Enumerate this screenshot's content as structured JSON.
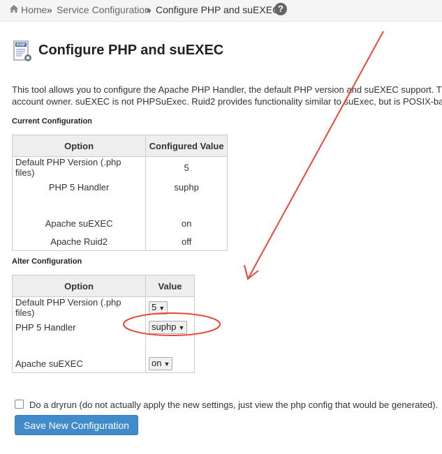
{
  "breadcrumb": {
    "home": "Home",
    "sep": "»",
    "service_config": "Service Configuration",
    "current": "Configure PHP and suEXEC",
    "help": "?"
  },
  "page": {
    "title": "Configure PHP and suEXEC",
    "desc_line1": "This tool allows you to configure the Apache PHP Handler, the default PHP version and suEXEC support. T",
    "desc_line2": "account owner. suEXEC is not PHPSuExec. Ruid2 provides functionality similar to suExec, but is POSIX-ba"
  },
  "current": {
    "heading": "Current Configuration",
    "col_option": "Option",
    "col_value": "Configured Value",
    "rows": [
      {
        "option": "Default PHP Version (.php files)",
        "value": "5"
      },
      {
        "option": "PHP 5 Handler",
        "value": "suphp"
      },
      {
        "option": "",
        "value": ""
      },
      {
        "option": "Apache suEXEC",
        "value": "on"
      },
      {
        "option": "Apache Ruid2",
        "value": "off"
      }
    ]
  },
  "alter": {
    "heading": "Alter Configuration",
    "col_option": "Option",
    "col_value": "Value",
    "rows": [
      {
        "option": "Default PHP Version (.php files)",
        "value": "5"
      },
      {
        "option": "PHP 5 Handler",
        "value": "suphp"
      },
      {
        "option": "",
        "value": ""
      },
      {
        "option": "Apache suEXEC",
        "value": "on"
      }
    ]
  },
  "dryrun_label": "Do a dryrun (do not actually apply the new settings, just view the php config that would be generated).",
  "save_label": "Save New Configuration",
  "colors": {
    "primary_button": "#428bca",
    "annotation": "#e8473a"
  }
}
